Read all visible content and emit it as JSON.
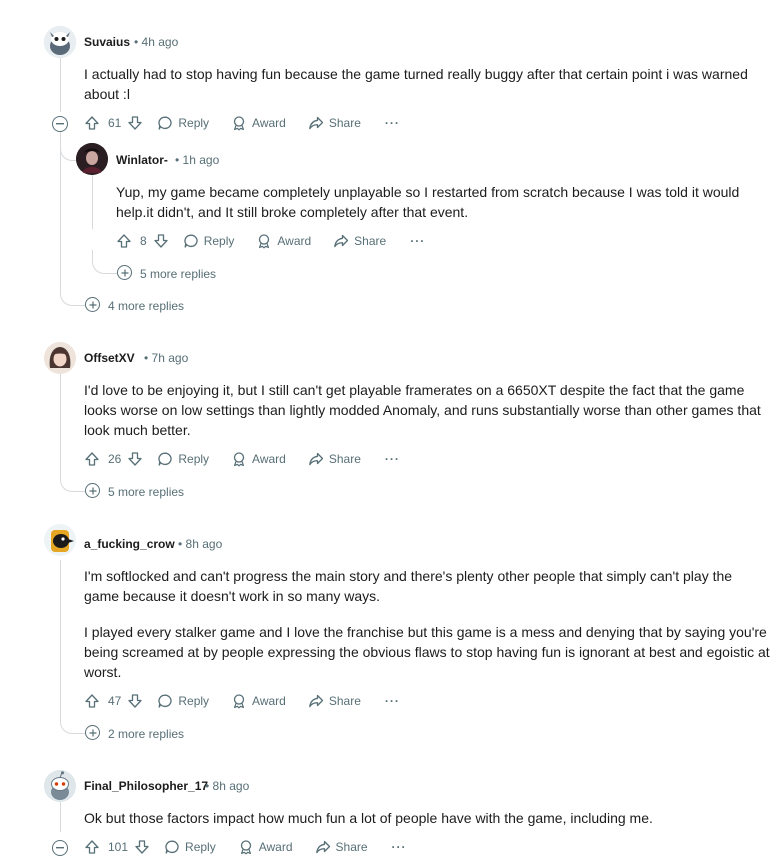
{
  "comments": [
    {
      "author": "Suvaius",
      "time": "4h ago",
      "body_lines": [
        "I actually had to stop having fun because the game turned really buggy after that certain point i was warned",
        "about :l"
      ],
      "votes": "61",
      "reply": "Reply",
      "award": "Award",
      "share": "Share",
      "menu": "···",
      "more_replies": "4 more replies",
      "replies": [
        {
          "author": "Winlator-",
          "time": "1h ago",
          "body_lines": [
            "Yup, my game became completely unplayable so I restarted from scratch because I was told it would",
            "help.it didn't, and It still broke completely after that event."
          ],
          "votes": "8",
          "reply": "Reply",
          "award": "Award",
          "share": "Share",
          "menu": "···",
          "more_replies": "5 more replies"
        }
      ]
    },
    {
      "author": "OffsetXV",
      "time": "7h ago",
      "body_lines": [
        "I'd love to be enjoying it, but I still can't get playable framerates on a 6650XT despite the fact that the game",
        "looks worse on low settings than lightly modded Anomaly, and runs substantially worse than other games that",
        "look much better."
      ],
      "votes": "26",
      "reply": "Reply",
      "award": "Award",
      "share": "Share",
      "menu": "···",
      "more_replies": "5 more replies"
    },
    {
      "author": "a_fucking_crow",
      "time": "8h ago",
      "body_lines": [
        "I'm softlocked and can't progress the main story and there's plenty other people that simply can't play the",
        "game because it doesn't work in so many ways."
      ],
      "body2_lines": [
        "I played every stalker game and I love the franchise but this game is a mess and denying that by saying you're",
        "being screamed at by people expressing the obvious flaws to stop having fun is ignorant at best and egoistic at",
        "worst."
      ],
      "votes": "47",
      "reply": "Reply",
      "award": "Award",
      "share": "Share",
      "menu": "···",
      "more_replies": "2 more replies"
    },
    {
      "author": "Final_Philosopher_17",
      "time": "8h ago",
      "body_lines": [
        "Ok but those factors impact how much fun a lot of people have with the game, including me."
      ],
      "votes": "101",
      "reply": "Reply",
      "award": "Award",
      "share": "Share",
      "menu": "···"
    }
  ],
  "separator": "•",
  "colors": {
    "text": "#1c1c1c",
    "meta": "#576f76",
    "thread": "#d7dadc"
  }
}
